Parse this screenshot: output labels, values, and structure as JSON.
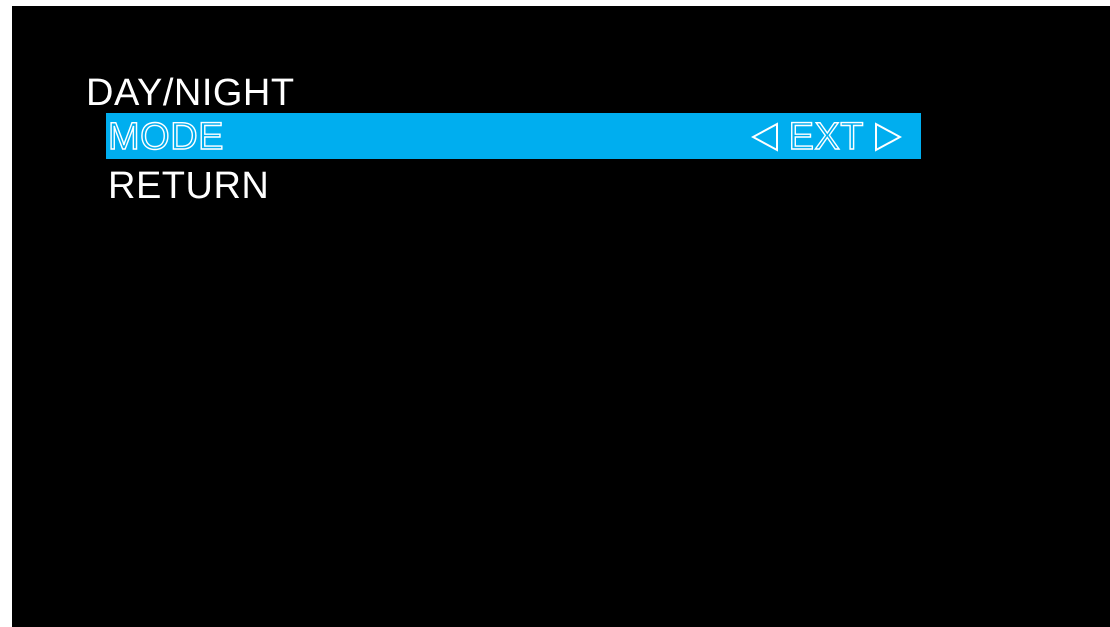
{
  "menu": {
    "title": "DAY/NIGHT",
    "items": [
      {
        "label": "MODE",
        "value": "EXT",
        "selected": true
      },
      {
        "label": "RETURN",
        "value": "",
        "selected": false
      }
    ]
  },
  "icons": {
    "left": "arrow-left-icon",
    "right": "arrow-right-icon"
  },
  "colors": {
    "background": "#000000",
    "highlight": "#00aeef",
    "text": "#ffffff"
  }
}
